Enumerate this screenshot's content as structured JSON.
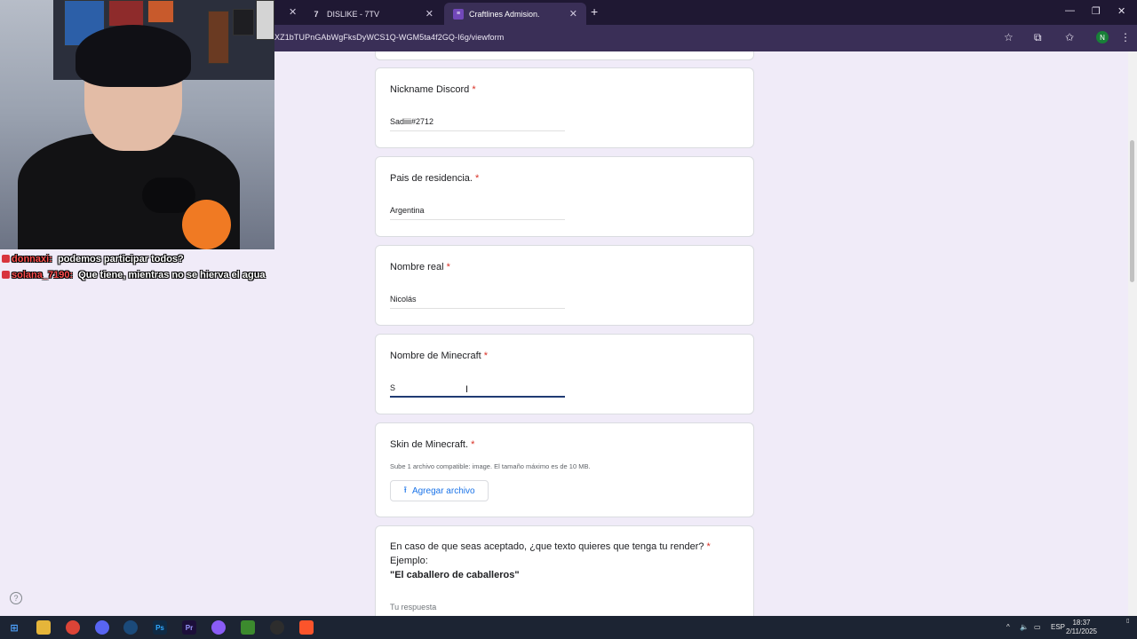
{
  "browser": {
    "tabs": [
      {
        "title": "DISLIKE - 7TV",
        "icon": "7tv-icon"
      },
      {
        "title": "Craftlines Admision.",
        "icon": "forms-icon"
      }
    ],
    "url": "XZ1bTUPnGAbWgFksDyWCS1Q-WGM5ta4f2GQ-I6g/viewform",
    "profile_initial": "N"
  },
  "chat": [
    {
      "user": "donnaxi:",
      "message": "podemos participar todos?"
    },
    {
      "user": "solana_7190:",
      "message": "Que tiene, mientras no se hierva el agua"
    }
  ],
  "form": {
    "questions": [
      {
        "title": "Nickname Discord",
        "required": "*",
        "answer": "Sadiiii#2712"
      },
      {
        "title": "Pais de residencia.",
        "required": "*",
        "answer": "Argentina"
      },
      {
        "title": "Nombre real",
        "required": "*",
        "answer": "Nicolás"
      },
      {
        "title": "Nombre de Minecraft",
        "required": "*",
        "answer": "S"
      },
      {
        "title": "Skin de Minecraft.",
        "required": "*",
        "note": "Sube 1 archivo compatible: image. El tamaño máximo es de 10 MB.",
        "button": "Agregar archivo"
      },
      {
        "title": "En caso de que seas aceptado, ¿que texto quieres que tenga tu render?",
        "required": "*",
        "line2": "Ejemplo:",
        "line3": "\"El caballero de caballeros\"",
        "placeholder": "Tu respuesta"
      }
    ]
  },
  "taskbar": {
    "lang": "ESP",
    "time": "18:37",
    "date": "2/11/2025"
  }
}
